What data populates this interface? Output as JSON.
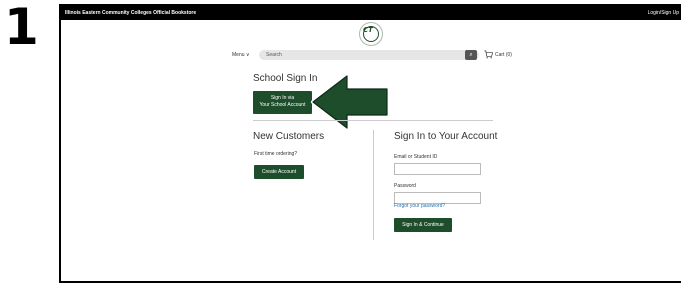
{
  "step_number": "1",
  "topbar": {
    "site_name": "Illinois Eastern Community Colleges Official Bookstore",
    "login": "Login/Sign Up"
  },
  "logo": {
    "letters": "CT"
  },
  "nav": {
    "menu_label": "Menu ∨",
    "search_placeholder": "Search",
    "cart_label": "Cart (0)"
  },
  "school_signin": {
    "heading": "School Sign In",
    "button_line1": "Sign In via",
    "button_line2": "Your School Account"
  },
  "new_customers": {
    "heading": "New Customers",
    "text": "First time ordering?",
    "button": "Create Account"
  },
  "account_signin": {
    "heading": "Sign In to Your Account",
    "email_label": "Email or Student ID",
    "password_label": "Password",
    "forgot_link": "Forgot your password?",
    "button": "Sign In & Continue"
  },
  "colors": {
    "brand_green": "#1e4d2b",
    "link_blue": "#2a6fa8"
  }
}
